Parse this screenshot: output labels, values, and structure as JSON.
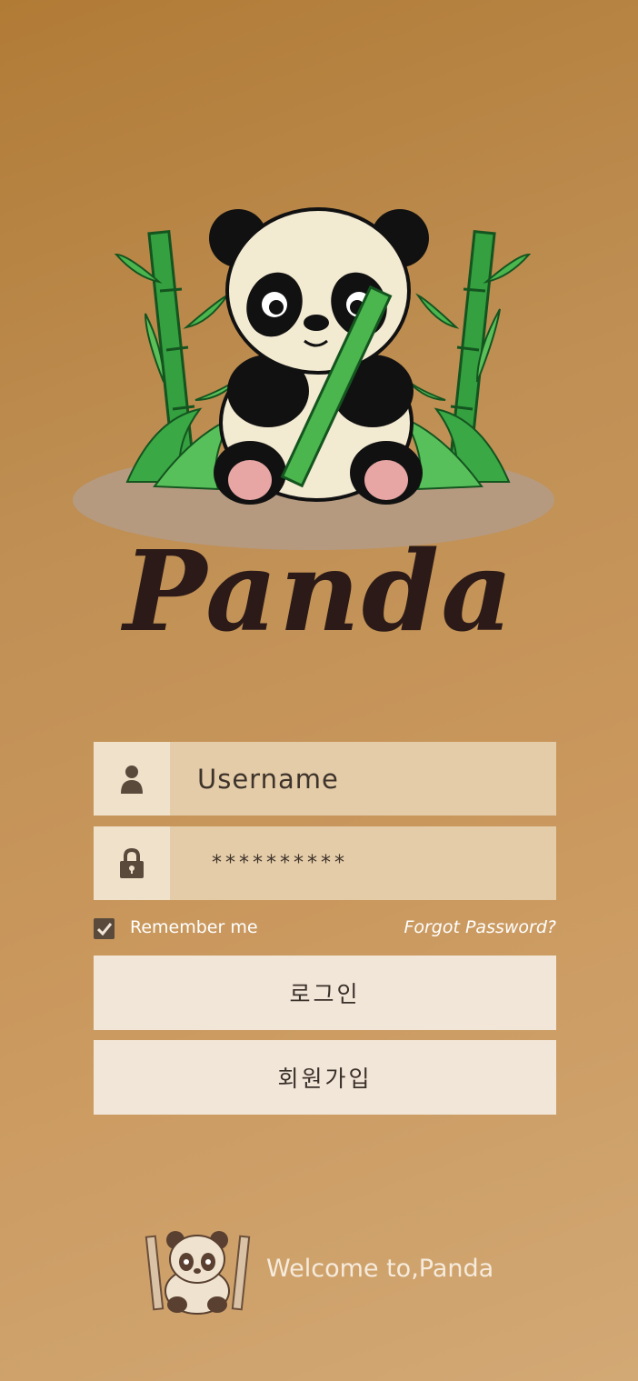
{
  "app": {
    "logo_text": "Panda"
  },
  "login_form": {
    "username_placeholder": "Username",
    "password_value": "**********",
    "remember_me_label": "Remember me",
    "remember_me_checked": true,
    "forgot_password_label": "Forgot Password?",
    "login_button_label": "로그인",
    "signup_button_label": "회원가입"
  },
  "footer": {
    "welcome_text": "Welcome to,Panda"
  },
  "icons": {
    "username": "user-icon",
    "password": "lock-icon",
    "checkbox": "checkmark-icon"
  },
  "colors": {
    "background_start": "#b17b36",
    "background_end": "#d2a874",
    "field_bg": "#e4cca8",
    "icon_cell_bg": "#f0e1cb",
    "button_bg": "#f2e6d8",
    "logo_text": "#2b1a17"
  }
}
